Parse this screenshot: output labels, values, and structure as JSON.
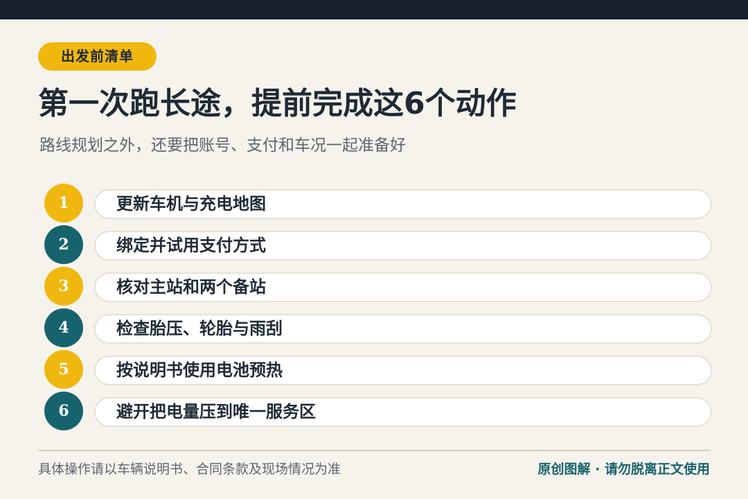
{
  "tag": "出发前清单",
  "title": "第一次跑长途，提前完成这6个动作",
  "subtitle": "路线规划之外，还要把账号、支付和车况一起准备好",
  "colors": {
    "gold": "#f0b70f",
    "teal": "#17636d",
    "dark": "#17212d",
    "background": "#f6f3ec"
  },
  "items": [
    {
      "num": "1",
      "text": "更新车机与充电地图",
      "color": "gold"
    },
    {
      "num": "2",
      "text": "绑定并试用支付方式",
      "color": "teal"
    },
    {
      "num": "3",
      "text": "核对主站和两个备站",
      "color": "gold"
    },
    {
      "num": "4",
      "text": "检查胎压、轮胎与雨刮",
      "color": "teal"
    },
    {
      "num": "5",
      "text": "按说明书使用电池预热",
      "color": "gold"
    },
    {
      "num": "6",
      "text": "避开把电量压到唯一服务区",
      "color": "teal"
    }
  ],
  "footer": {
    "note": "具体操作请以车辆说明书、合同条款及现场情况为准",
    "credit": "原创图解 · 请勿脱离正文使用"
  }
}
